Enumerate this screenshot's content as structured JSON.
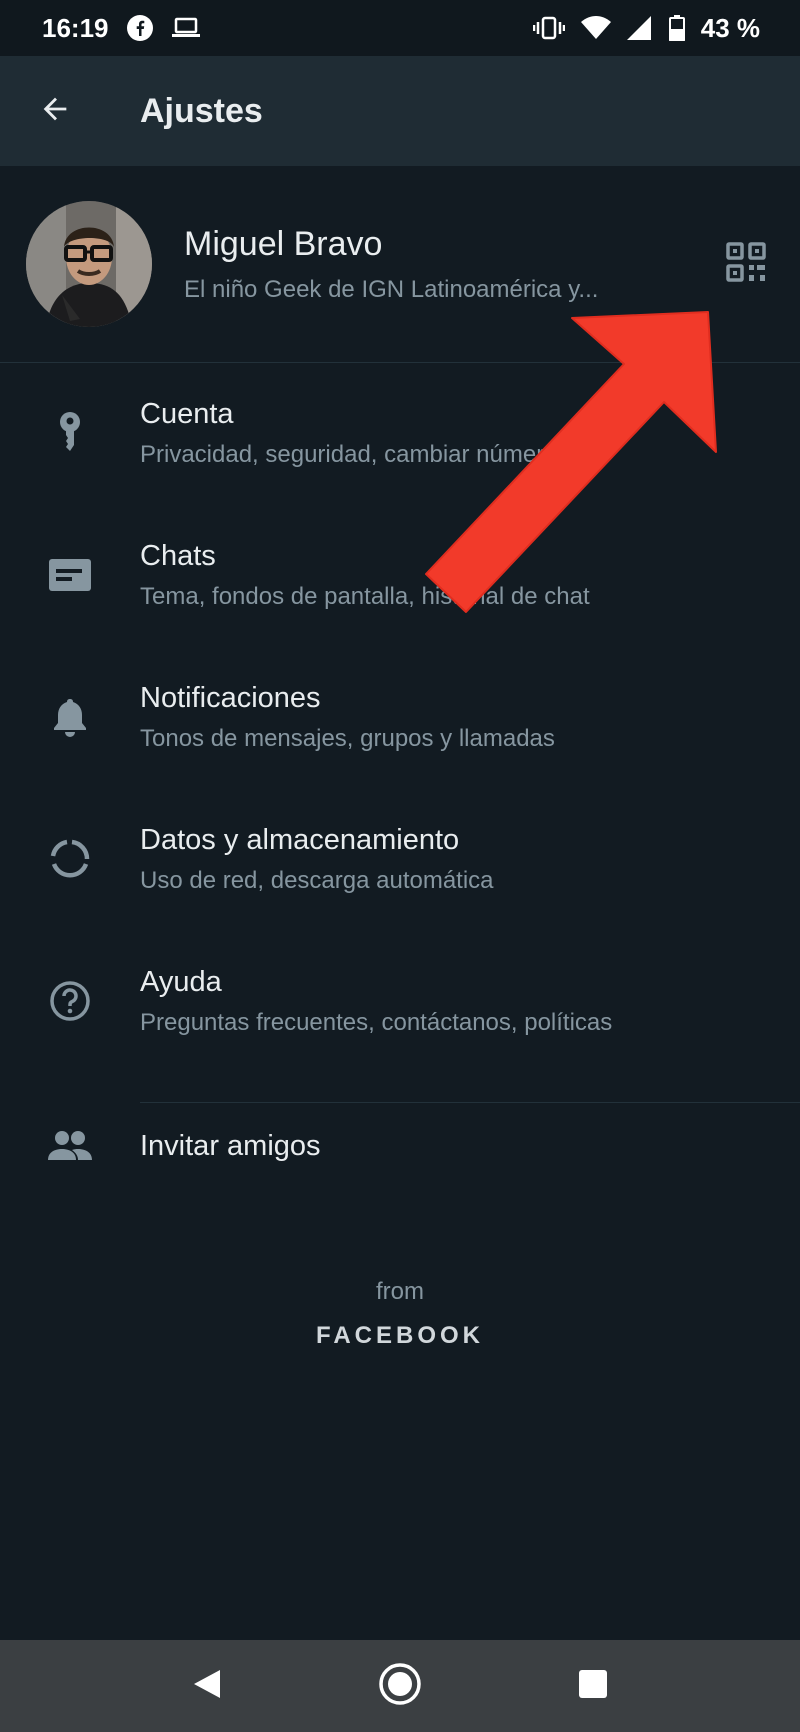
{
  "status_bar": {
    "time": "16:19",
    "battery": "43 %",
    "icons": [
      "facebook-icon",
      "laptop-icon",
      "vibrate-icon",
      "wifi-icon",
      "signal-icon",
      "battery-icon"
    ]
  },
  "app_bar": {
    "title": "Ajustes",
    "back_icon": "arrow-left-icon"
  },
  "profile": {
    "name": "Miguel Bravo",
    "status": "El niño Geek de IGN Latinoamérica y...",
    "qr_icon": "qr-code-icon"
  },
  "menu": {
    "items": [
      {
        "title": "Cuenta",
        "subtitle": "Privacidad, seguridad, cambiar número",
        "icon": "key-icon"
      },
      {
        "title": "Chats",
        "subtitle": "Tema, fondos de pantalla, historial de chat",
        "icon": "chat-icon"
      },
      {
        "title": "Notificaciones",
        "subtitle": "Tonos de mensajes, grupos y llamadas",
        "icon": "bell-icon"
      },
      {
        "title": "Datos y almacenamiento",
        "subtitle": "Uso de red, descarga automática",
        "icon": "data-usage-icon"
      },
      {
        "title": "Ayuda",
        "subtitle": "Preguntas frecuentes, contáctanos, políticas",
        "icon": "help-icon"
      }
    ],
    "invite": {
      "title": "Invitar amigos",
      "icon": "people-icon"
    }
  },
  "footer": {
    "from": "from",
    "brand": "FACEBOOK"
  },
  "colors": {
    "background": "#121b22",
    "app_bar": "#1f2c34",
    "primary_text": "#e9edef",
    "secondary_text": "#8696a0",
    "annotation_arrow": "#f23a2a"
  }
}
